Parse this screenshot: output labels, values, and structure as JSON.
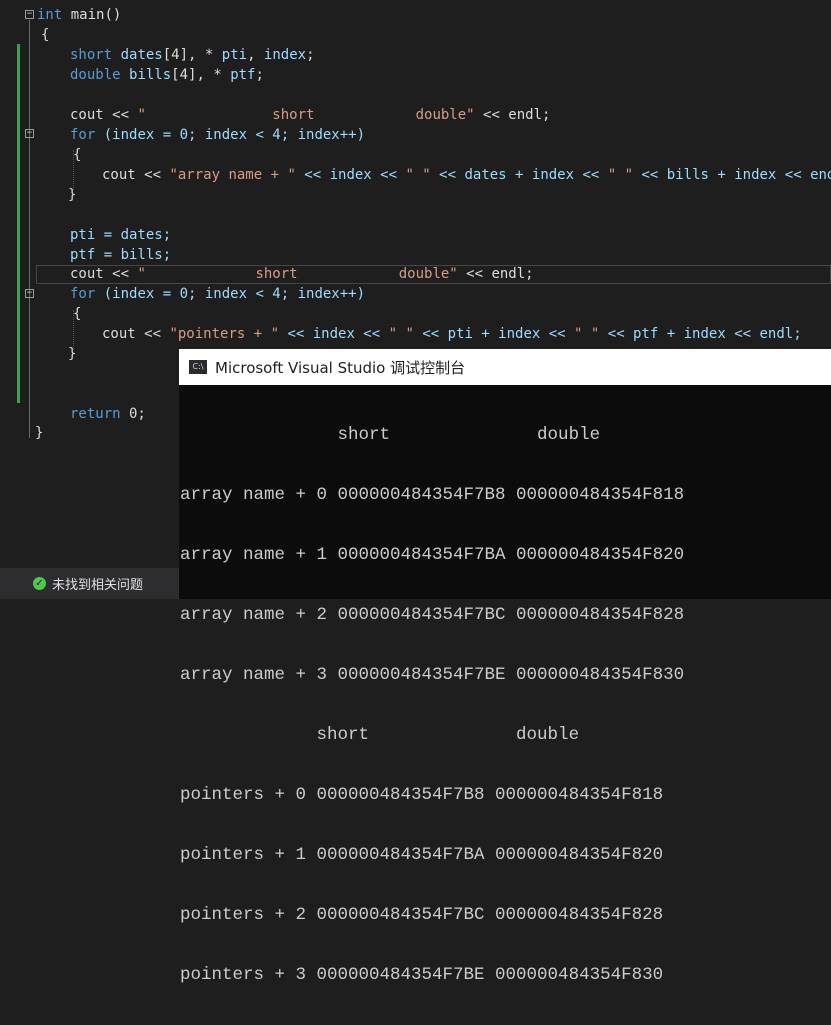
{
  "code": {
    "l1_kw": "int",
    "l1_rest": " main()",
    "l2": "{",
    "l3_kw": "short",
    "l3_rest_a": " ",
    "l3_id1": "dates",
    "l3_rest_b": "[4], * ",
    "l3_id2": "pti",
    "l3_rest_c": ", ",
    "l3_id3": "index",
    "l3_rest_d": ";",
    "l4_kw": "double",
    "l4_rest_a": " ",
    "l4_id1": "bills",
    "l4_rest_b": "[4], * ",
    "l4_id2": "ptf",
    "l4_rest_c": ";",
    "l6_a": "cout << ",
    "l6_str": "\"               short            double\"",
    "l6_b": " << endl;",
    "l7_kw": "for",
    "l7_rest": " (index = 0; index < 4; index++)",
    "l8": "{",
    "l9_a": "cout << ",
    "l9_str": "\"array name + \"",
    "l9_b": " << index << ",
    "l9_str2": "\" \"",
    "l9_c": " << dates + index << ",
    "l9_str3": "\" \"",
    "l9_d": " << bills + index << endl;",
    "l10": "}",
    "l12": "pti = dates;",
    "l13": "ptf = bills;",
    "l14_a": "cout << ",
    "l14_str": "\"             short            double\"",
    "l14_b": " << endl;",
    "l15_kw": "for",
    "l15_rest": " (index = 0; index < 4; index++)",
    "l16": "{",
    "l17_a": "cout << ",
    "l17_str": "\"pointers + \"",
    "l17_b": " << index << ",
    "l17_str2": "\" \"",
    "l17_c": " << pti + index << ",
    "l17_str3": "\" \"",
    "l17_d": " << ptf + index << endl;",
    "l18": "}",
    "l21_kw": "return",
    "l21_rest": " 0;",
    "l22": "}"
  },
  "status": {
    "icon": "check-icon",
    "text": "未找到相关问题"
  },
  "console": {
    "title": "Microsoft Visual Studio 调试控制台",
    "icon_label": "C:\\",
    "lines": [
      "               short              double",
      "array name + 0 000000484354F7B8 000000484354F818",
      "array name + 1 000000484354F7BA 000000484354F820",
      "array name + 2 000000484354F7BC 000000484354F828",
      "array name + 3 000000484354F7BE 000000484354F830",
      "             short              double",
      "pointers + 0 000000484354F7B8 000000484354F818",
      "pointers + 1 000000484354F7BA 000000484354F820",
      "pointers + 2 000000484354F7BC 000000484354F828",
      "pointers + 3 000000484354F7BE 000000484354F830"
    ]
  },
  "colors": {
    "editor_bg": "#1e1e1e",
    "keyword": "#569cd6",
    "string": "#d69d85",
    "change_bar": "#3fa34d"
  }
}
